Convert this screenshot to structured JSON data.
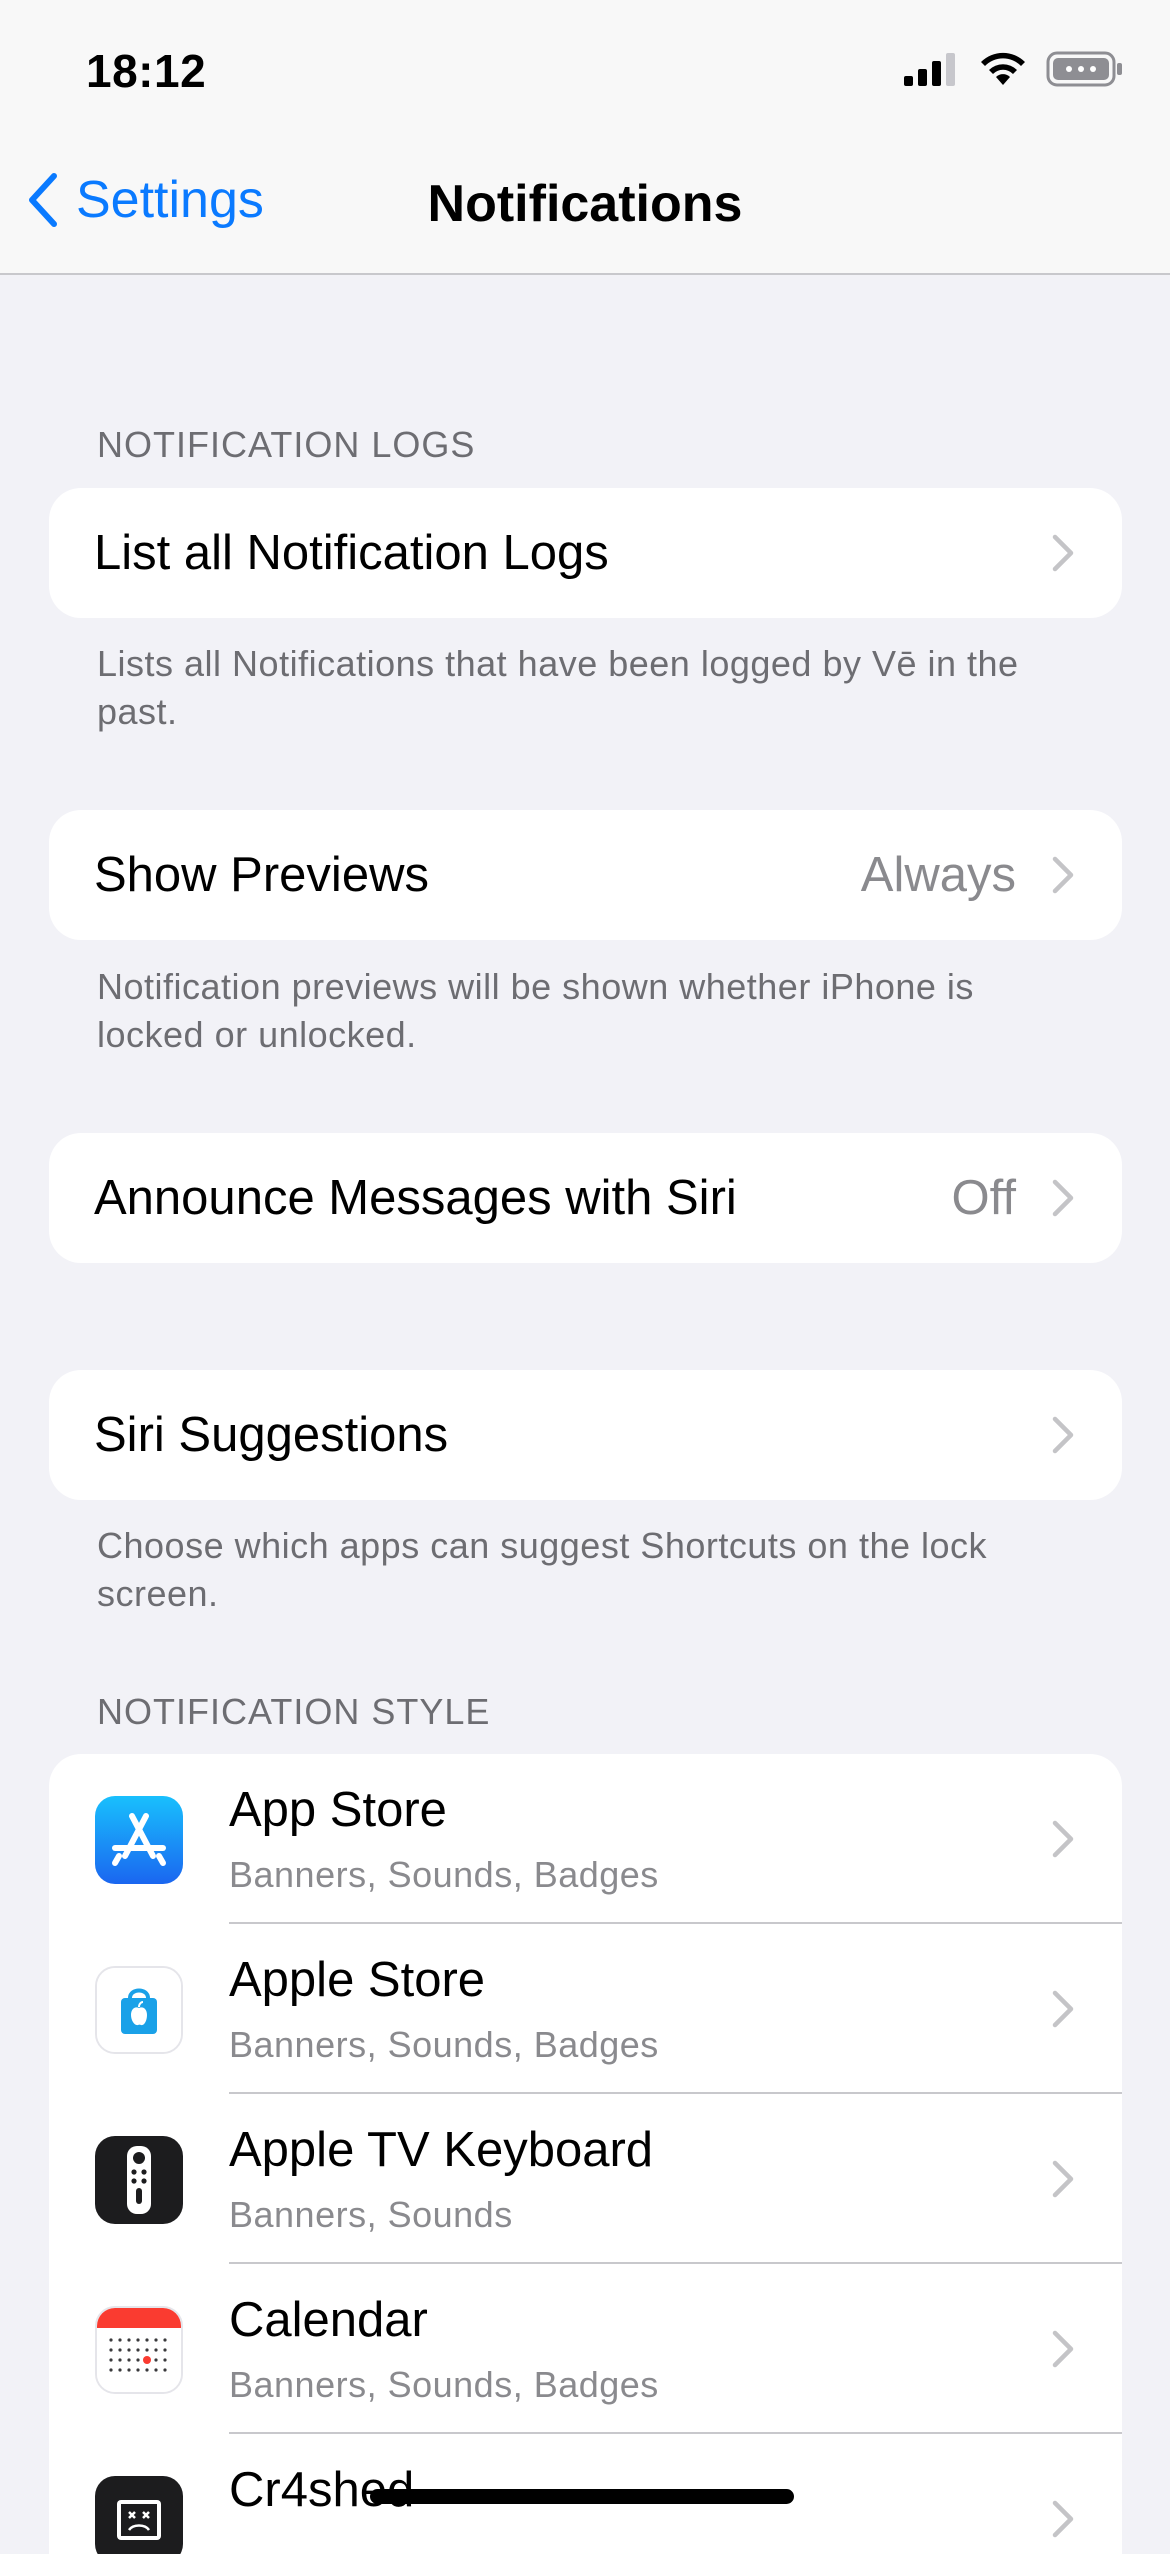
{
  "status_bar": {
    "time": "18:12",
    "icons": [
      "signal-icon",
      "wifi-icon",
      "battery-icon"
    ]
  },
  "nav": {
    "back_label": "Settings",
    "title": "Notifications",
    "accent_color": "#0a7aff"
  },
  "logs": {
    "header": "NOTIFICATION LOGS",
    "row_label": "List all Notification Logs",
    "footer": "Lists all Notifications that have been logged by Vē in the past."
  },
  "previews": {
    "label": "Show Previews",
    "value": "Always",
    "footer": "Notification previews will be shown whether iPhone is locked or unlocked."
  },
  "announce": {
    "label": "Announce Messages with Siri",
    "value": "Off"
  },
  "siri": {
    "label": "Siri Suggestions",
    "footer": "Choose which apps can suggest Shortcuts on the lock screen."
  },
  "style": {
    "header": "NOTIFICATION STYLE",
    "apps": [
      {
        "name": "App Store",
        "sub": "Banners, Sounds, Badges",
        "icon": "app-store-icon"
      },
      {
        "name": "Apple Store",
        "sub": "Banners, Sounds, Badges",
        "icon": "apple-store-icon"
      },
      {
        "name": "Apple TV Keyboard",
        "sub": "Banners, Sounds",
        "icon": "apple-tv-remote-icon"
      },
      {
        "name": "Calendar",
        "sub": "Banners, Sounds, Badges",
        "icon": "calendar-icon"
      },
      {
        "name": "Cr4shed",
        "sub": "",
        "icon": "cr4shed-icon"
      }
    ]
  }
}
